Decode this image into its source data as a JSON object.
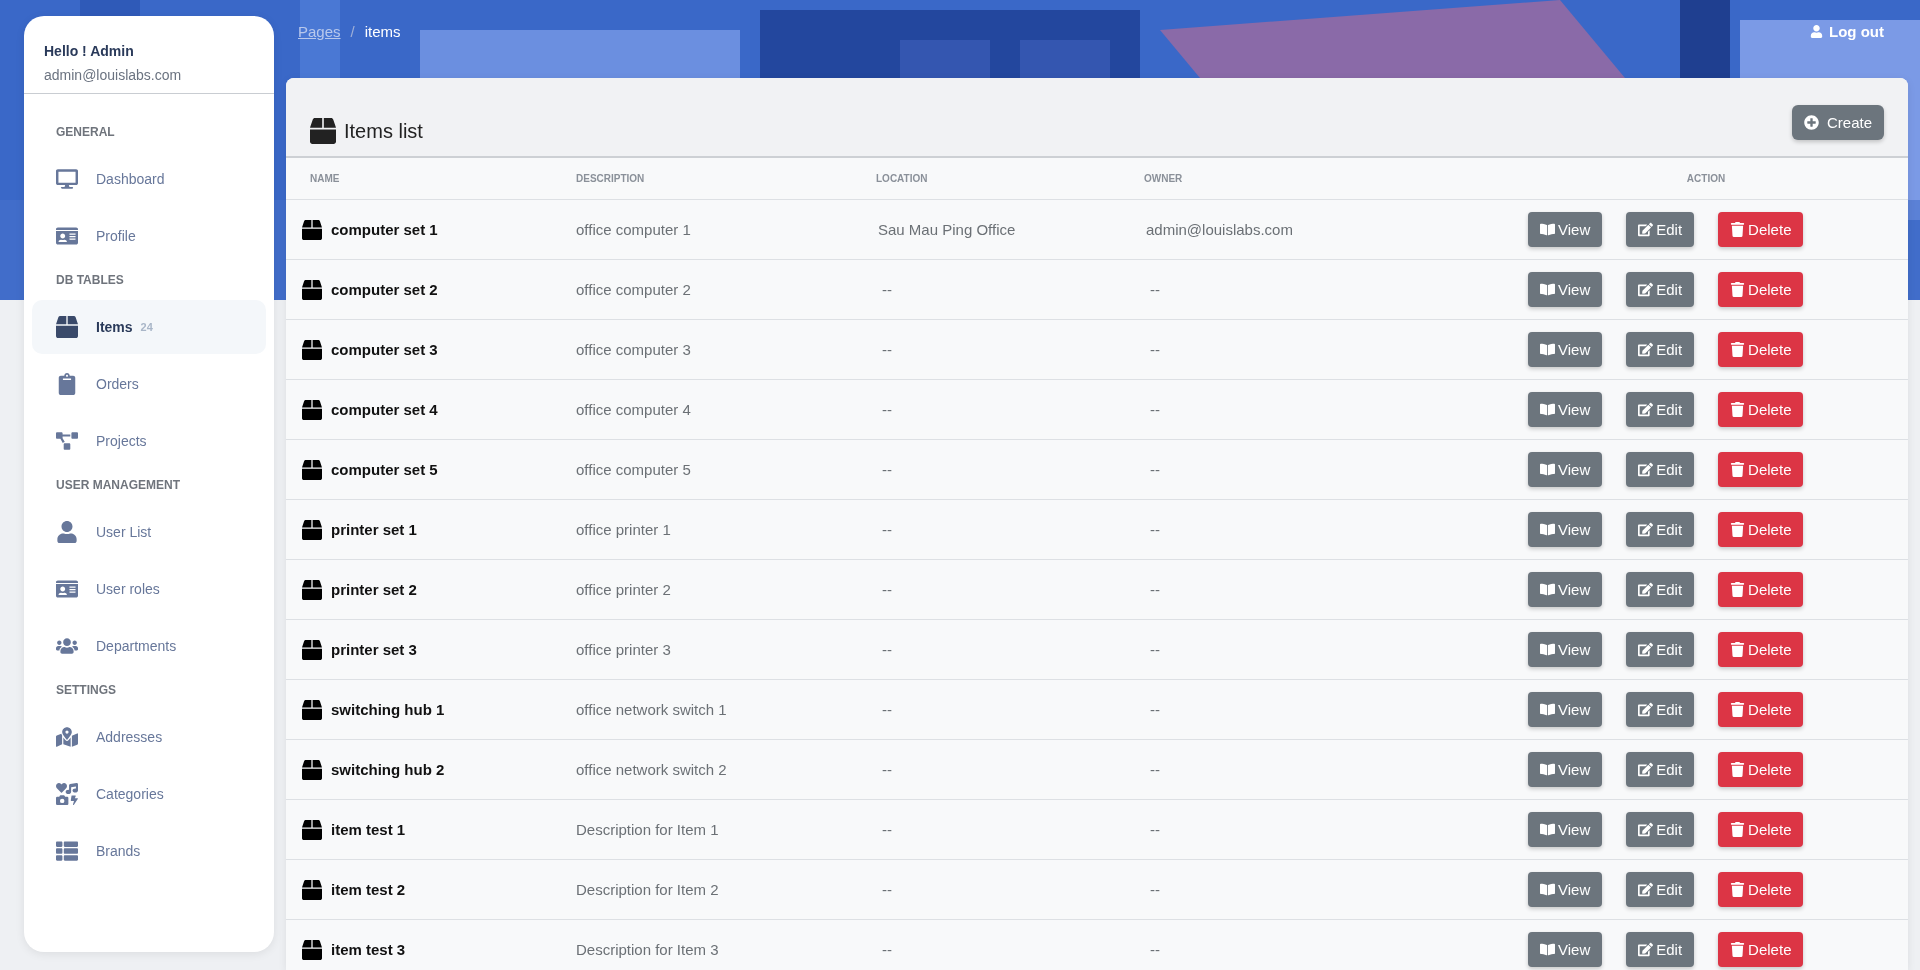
{
  "user": {
    "greeting": "Hello ! Admin",
    "email": "admin@louislabs.com"
  },
  "sidebar": {
    "sections": [
      {
        "title": "GENERAL",
        "items": [
          {
            "label": "Dashboard",
            "selected": false
          },
          {
            "label": "Profile",
            "selected": false
          }
        ]
      },
      {
        "title": "DB TABLES",
        "items": [
          {
            "label": "Items",
            "selected": true,
            "badge": "24"
          },
          {
            "label": "Orders",
            "selected": false
          },
          {
            "label": "Projects",
            "selected": false
          }
        ]
      },
      {
        "title": "USER MANAGEMENT",
        "items": [
          {
            "label": "User List",
            "selected": false
          },
          {
            "label": "User roles",
            "selected": false
          },
          {
            "label": "Departments",
            "selected": false
          }
        ]
      },
      {
        "title": "SETTINGS",
        "items": [
          {
            "label": "Addresses",
            "selected": false
          },
          {
            "label": "Categories",
            "selected": false
          },
          {
            "label": "Brands",
            "selected": false
          }
        ]
      }
    ]
  },
  "breadcrumb": {
    "link": "Pages",
    "separator": "/",
    "current": "items"
  },
  "logout": "Log out",
  "card": {
    "title": "Items list",
    "create_button": "Create"
  },
  "table": {
    "columns": [
      "NAME",
      "DESCRIPTION",
      "LOCATION",
      "OWNER",
      "ACTION"
    ],
    "rows": [
      {
        "name": "computer set 1",
        "description": "office computer 1",
        "location": "Sau Mau Ping Office",
        "owner": "admin@louislabs.com",
        "actions": [
          "View",
          "Edit",
          "Delete"
        ]
      },
      {
        "name": "computer set 2",
        "description": "office computer 2",
        "location": "--",
        "owner": "--",
        "actions": [
          "View",
          "Edit",
          "Delete"
        ]
      },
      {
        "name": "computer set 3",
        "description": "office computer 3",
        "location": "--",
        "owner": "--",
        "actions": [
          "View",
          "Edit",
          "Delete"
        ]
      },
      {
        "name": "computer set 4",
        "description": "office computer 4",
        "location": "--",
        "owner": "--",
        "actions": [
          "View",
          "Edit",
          "Delete"
        ]
      },
      {
        "name": "computer set 5",
        "description": "office computer 5",
        "location": "--",
        "owner": "--",
        "actions": [
          "View",
          "Edit",
          "Delete"
        ]
      },
      {
        "name": "printer set 1",
        "description": "office printer 1",
        "location": "--",
        "owner": "--",
        "actions": [
          "View",
          "Edit",
          "Delete"
        ]
      },
      {
        "name": "printer set 2",
        "description": "office printer 2",
        "location": "--",
        "owner": "--",
        "actions": [
          "View",
          "Edit",
          "Delete"
        ]
      },
      {
        "name": "printer set 3",
        "description": "office printer 3",
        "location": "--",
        "owner": "--",
        "actions": [
          "View",
          "Edit",
          "Delete"
        ]
      },
      {
        "name": "switching hub 1",
        "description": "office network switch 1",
        "location": "--",
        "owner": "--",
        "actions": [
          "View",
          "Edit",
          "Delete"
        ]
      },
      {
        "name": "switching hub 2",
        "description": "office network switch 2",
        "location": "--",
        "owner": "--",
        "actions": [
          "View",
          "Edit",
          "Delete"
        ]
      },
      {
        "name": "item test 1",
        "description": "Description for Item 1",
        "location": "--",
        "owner": "--",
        "actions": [
          "View",
          "Edit",
          "Delete"
        ]
      },
      {
        "name": "item test 2",
        "description": "Description for Item 2",
        "location": "--",
        "owner": "--",
        "actions": [
          "View",
          "Edit",
          "Delete"
        ]
      },
      {
        "name": "item test 3",
        "description": "Description for Item 3",
        "location": "--",
        "owner": "--",
        "actions": [
          "View",
          "Edit",
          "Delete"
        ]
      }
    ]
  }
}
